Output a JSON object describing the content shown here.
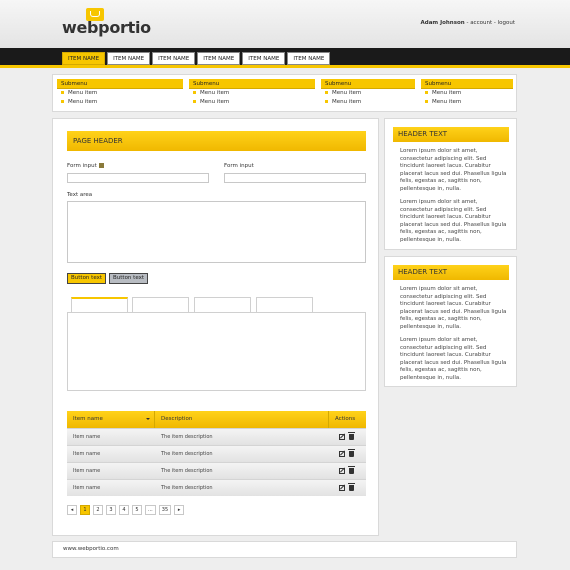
{
  "brand": {
    "name": "webportio"
  },
  "user": {
    "name": "Adam Johnson",
    "sep1": " - ",
    "account": "account",
    "sep2": " - ",
    "logout": "logout"
  },
  "nav": {
    "items": [
      "ITEM NAME",
      "ITEM NAME",
      "ITEM NAME",
      "ITEM NAME",
      "ITEM NAME",
      "ITEM NAME"
    ],
    "active_index": 0
  },
  "submenus": [
    {
      "title": "Submenu",
      "items": [
        "Menu item",
        "Menu item"
      ]
    },
    {
      "title": "Submenu",
      "items": [
        "Menu item",
        "Menu item"
      ]
    },
    {
      "title": "Submenu",
      "items": [
        "Menu item",
        "Menu item"
      ]
    },
    {
      "title": "Submenu",
      "items": [
        "Menu item",
        "Menu item"
      ]
    }
  ],
  "form": {
    "page_header": "PAGE HEADER",
    "input1_label": "Form input",
    "input2_label": "Form input",
    "textarea_label": "Text area",
    "button_primary": "Button text",
    "button_secondary": "Button text"
  },
  "table": {
    "headers": [
      "Item name",
      "Description",
      "Actions"
    ],
    "rows": [
      [
        "Item name",
        "The item description"
      ],
      [
        "Item name",
        "The item description"
      ],
      [
        "Item name",
        "The item description"
      ],
      [
        "Item name",
        "The item description"
      ]
    ]
  },
  "pager": {
    "pages": [
      "1",
      "2",
      "3",
      "4",
      "5",
      "...",
      "35"
    ],
    "current": "1"
  },
  "sidebar": [
    {
      "header": "HEADER TEXT",
      "paragraphs": [
        "Lorem ipsum dolor sit amet, consectetur adipiscing elit. Sed tincidunt laoreet lacus. Curabitur placerat lacus sed dui. Phasellus ligula felis, egestas ac, sagittis non, pellentesque in, nulla.",
        "Lorem ipsum dolor sit amet, consectetur adipiscing elit. Sed tincidunt laoreet lacus. Curabitur placerat lacus sed dui. Phasellus ligula felis, egestas ac, sagittis non, pellentesque in, nulla."
      ]
    },
    {
      "header": "HEADER TEXT",
      "paragraphs": [
        "Lorem ipsum dolor sit amet, consectetur adipiscing elit. Sed tincidunt laoreet lacus. Curabitur placerat lacus sed dui. Phasellus ligula felis, egestas ac, sagittis non, pellentesque in, nulla.",
        "Lorem ipsum dolor sit amet, consectetur adipiscing elit. Sed tincidunt laoreet lacus. Curabitur placerat lacus sed dui. Phasellus ligula felis, egestas ac, sagittis non, pellentesque in, nulla."
      ]
    }
  ],
  "footer": {
    "text": "www.webportio.com"
  },
  "colors": {
    "accent": "#f7c600",
    "nav_bg": "#1a1a1a"
  }
}
